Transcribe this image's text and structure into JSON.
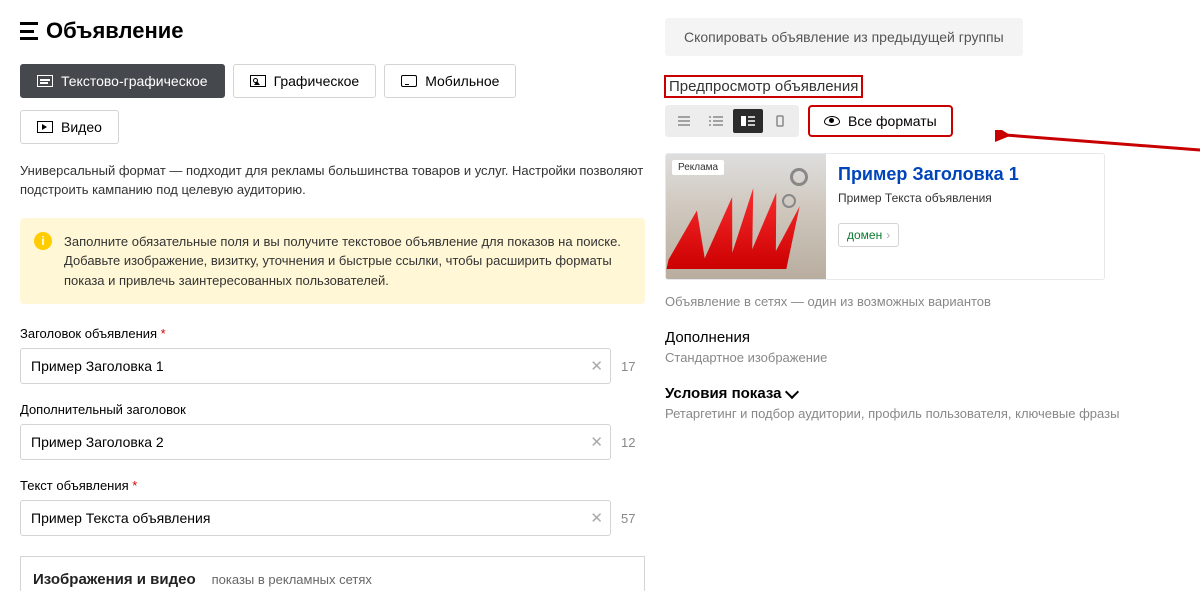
{
  "left": {
    "page_title": "Объявление",
    "tabs": [
      {
        "label": "Текстово-графическое",
        "active": true
      },
      {
        "label": "Графическое"
      },
      {
        "label": "Мобильное"
      },
      {
        "label": "Видео"
      }
    ],
    "format_description": "Универсальный формат — подходит для рекламы большинства товаров и услуг. Настройки позволяют подстроить кампанию под целевую аудиторию.",
    "info_text": "Заполните обязательные поля и вы получите текстовое объявление для показов на поиске. Добавьте изображение, визитку, уточнения и быстрые ссылки, чтобы расширить форматы показа и привлечь заинтересованных пользователей.",
    "fields": {
      "title1": {
        "label": "Заголовок объявления",
        "required": true,
        "value": "Пример Заголовка 1",
        "counter": "17"
      },
      "title2": {
        "label": "Дополнительный заголовок",
        "required": false,
        "value": "Пример Заголовка 2",
        "counter": "12"
      },
      "text": {
        "label": "Текст объявления",
        "required": true,
        "value": "Пример Текста объявления",
        "counter": "57"
      }
    },
    "images_section": {
      "title": "Изображения и видео",
      "subtitle": "показы в рекламных сетях"
    }
  },
  "right": {
    "copy_button": "Скопировать объявление из предыдущей группы",
    "preview_title": "Предпросмотр объявления",
    "all_formats_label": "Все форматы",
    "ad_label": "Реклама",
    "ad": {
      "title": "Пример Заголовка 1",
      "text": "Пример Текста объявления",
      "domain": "домен"
    },
    "preview_note": "Объявление в сетях — один из возможных вариантов",
    "addons_title": "Дополнения",
    "addons_text": "Стандартное изображение",
    "conditions_title": "Условия показа",
    "conditions_text": "Ретаргетинг и подбор аудитории, профиль пользователя, ключевые фразы"
  }
}
